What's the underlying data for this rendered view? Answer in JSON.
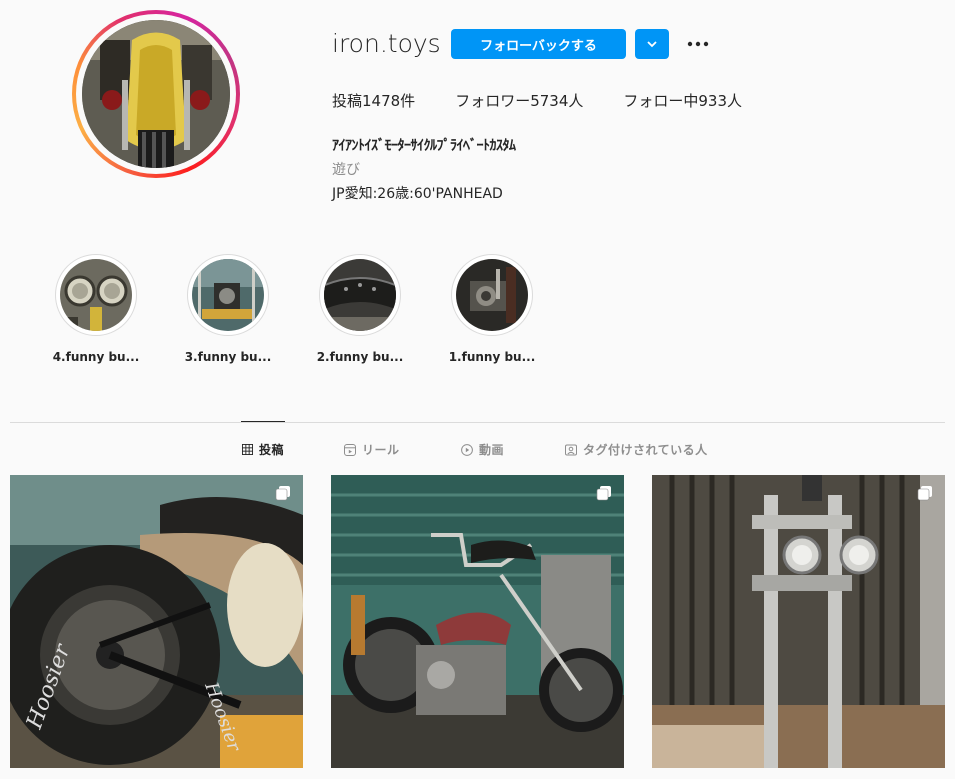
{
  "profile": {
    "username": "iron.toys",
    "follow_back_label": "フォローバックする",
    "stats": {
      "posts": "投稿1478件",
      "followers": "フォロワー5734人",
      "following": "フォロー中933人"
    },
    "full_name": "ｱｲｱﾝﾄｲｽﾞﾓｰﾀｰｻｲｸﾙﾌﾟﾗｲﾍﾞｰﾄｶｽﾀﾑ",
    "category": "遊び",
    "bio": "JP愛知:26歳:60'PANHEAD"
  },
  "highlights": [
    {
      "label": "4.funny bu..."
    },
    {
      "label": "3.funny bu..."
    },
    {
      "label": "2.funny bu..."
    },
    {
      "label": "1.funny bu..."
    }
  ],
  "tabs": [
    {
      "label": "投稿",
      "icon": "grid-icon",
      "active": true
    },
    {
      "label": "リール",
      "icon": "reels-icon",
      "active": false
    },
    {
      "label": "動画",
      "icon": "video-icon",
      "active": false
    },
    {
      "label": "タグ付けされている人",
      "icon": "tagged-icon",
      "active": false
    }
  ],
  "posts": [
    {
      "subject": "motorcycle rear wheel with Hoosier tire",
      "multi": true
    },
    {
      "subject": "chopper motorcycle in garage",
      "multi": true
    },
    {
      "subject": "springer front end with twin headlights",
      "multi": true
    }
  ],
  "colors": {
    "accent": "#0095f6",
    "text": "#262626",
    "muted": "#8e8e8e",
    "background": "#fafafa",
    "divider": "#dbdbdb"
  }
}
